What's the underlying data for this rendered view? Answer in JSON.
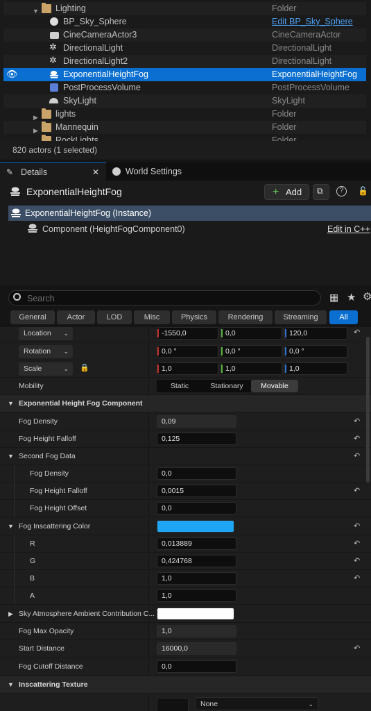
{
  "outliner": {
    "rows": [
      {
        "name": "Lighting",
        "type": "Folder"
      },
      {
        "name": "BP_Sky_Sphere",
        "type": "Edit BP_Sky_Sphere"
      },
      {
        "name": "CineCameraActor3",
        "type": "CineCameraActor"
      },
      {
        "name": "DirectionalLight",
        "type": "DirectionalLight"
      },
      {
        "name": "DirectionalLight2",
        "type": "DirectionalLight"
      },
      {
        "name": "ExponentialHeightFog",
        "type": "ExponentialHeightFog"
      },
      {
        "name": "PostProcessVolume",
        "type": "PostProcessVolume"
      },
      {
        "name": "SkyLight",
        "type": "SkyLight"
      },
      {
        "name": "lights",
        "type": "Folder"
      },
      {
        "name": "Mannequin",
        "type": "Folder"
      },
      {
        "name": "RockLights",
        "type": "Folder"
      }
    ],
    "status": "820 actors (1 selected)"
  },
  "tabs": {
    "details": "Details",
    "world_settings": "World Settings"
  },
  "header": {
    "actor_name": "ExponentialHeightFog",
    "add_label": "Add",
    "instance_label": "ExponentialHeightFog (Instance)",
    "component_label": "Component (HeightFogComponent0)",
    "edit_cpp": "Edit in C++"
  },
  "search": {
    "placeholder": "Search"
  },
  "category_tabs": [
    "General",
    "Actor",
    "LOD",
    "Misc",
    "Physics",
    "Rendering",
    "Streaming",
    "All"
  ],
  "transform": {
    "location_label": "Location",
    "location": [
      "-1550,0",
      "0,0",
      "120,0"
    ],
    "rotation_label": "Rotation",
    "rotation": [
      "0,0 °",
      "0,0 °",
      "0,0 °"
    ],
    "scale_label": "Scale",
    "scale": [
      "1,0",
      "1,0",
      "1,0"
    ],
    "mobility_label": "Mobility",
    "mobility_options": [
      "Static",
      "Stationary",
      "Movable"
    ],
    "mobility_selected": "Movable"
  },
  "fog": {
    "section": "Exponential Height Fog Component",
    "density_label": "Fog Density",
    "density": "0,09",
    "falloff_label": "Fog Height Falloff",
    "falloff": "0,125",
    "second_section": "Second Fog Data",
    "second_density_label": "Fog Density",
    "second_density": "0,0",
    "second_falloff_label": "Fog Height Falloff",
    "second_falloff": "0,0015",
    "second_offset_label": "Fog Height Offset",
    "second_offset": "0,0",
    "inscatter_label": "Fog Inscattering Color",
    "inscatter_color": "#1ea5f5",
    "r_label": "R",
    "r": "0,013889",
    "g_label": "G",
    "g": "0,424768",
    "b_label": "B",
    "b": "1,0",
    "a_label": "A",
    "a": "1,0",
    "sky_label": "Sky Atmosphere Ambient Contribution C...",
    "sky_color": "#ffffff",
    "max_opacity_label": "Fog Max Opacity",
    "max_opacity": "1,0",
    "start_distance_label": "Start Distance",
    "start_distance": "16000,0",
    "cutoff_label": "Fog Cutoff Distance",
    "cutoff": "0,0",
    "texture_section": "Inscattering Texture",
    "texture_value": "None"
  },
  "colors": {
    "accent": "#0a6fd0",
    "link": "#4ea1f5"
  }
}
